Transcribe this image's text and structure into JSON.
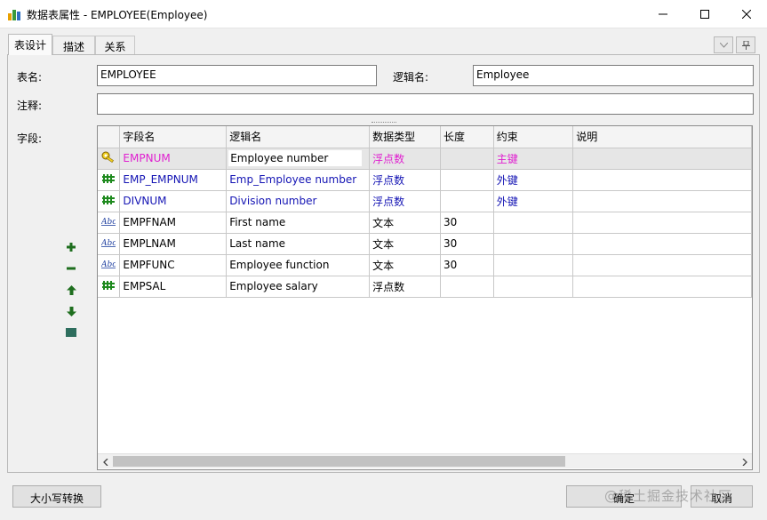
{
  "window": {
    "title": "数据表属性 - EMPLOYEE(Employee)"
  },
  "tabs": [
    "表设计",
    "描述",
    "关系"
  ],
  "form": {
    "table_name_label": "表名:",
    "table_name_value": "EMPLOYEE",
    "logical_name_label": "逻辑名:",
    "logical_name_value": "Employee",
    "comment_label": "注释:",
    "comment_value": "",
    "fields_label": "字段:"
  },
  "grid": {
    "columns": [
      "",
      "字段名",
      "逻辑名",
      "数据类型",
      "长度",
      "约束",
      "说明"
    ],
    "rows": [
      {
        "icon": "key-icon",
        "name": "EMPNUM",
        "logical": "Employee number",
        "type": "浮点数",
        "length": "",
        "constraint": "主键",
        "desc": "",
        "color": "pink"
      },
      {
        "icon": "numeric-icon",
        "name": "EMP_EMPNUM",
        "logical": "Emp_Employee number",
        "type": "浮点数",
        "length": "",
        "constraint": "外键",
        "desc": "",
        "color": "blue"
      },
      {
        "icon": "numeric-icon",
        "name": "DIVNUM",
        "logical": "Division number",
        "type": "浮点数",
        "length": "",
        "constraint": "外键",
        "desc": "",
        "color": "blue"
      },
      {
        "icon": "text-icon",
        "name": "EMPFNAM",
        "logical": "First name",
        "type": "文本",
        "length": "30",
        "constraint": "",
        "desc": "",
        "color": "black"
      },
      {
        "icon": "text-icon",
        "name": "EMPLNAM",
        "logical": "Last name",
        "type": "文本",
        "length": "30",
        "constraint": "",
        "desc": "",
        "color": "black"
      },
      {
        "icon": "text-icon",
        "name": "EMPFUNC",
        "logical": "Employee function",
        "type": "文本",
        "length": "30",
        "constraint": "",
        "desc": "",
        "color": "black"
      },
      {
        "icon": "numeric-icon",
        "name": "EMPSAL",
        "logical": "Employee salary",
        "type": "浮点数",
        "length": "",
        "constraint": "",
        "desc": "",
        "color": "black"
      }
    ]
  },
  "buttons": {
    "case_convert": "大小写转换",
    "ok": "确定",
    "cancel": "取消"
  },
  "watermark": "@稀土掘金技术社区",
  "colors": {
    "primary_key": "#e020d0",
    "foreign_key": "#1414b4",
    "grid_border": "#c8c8c8"
  }
}
